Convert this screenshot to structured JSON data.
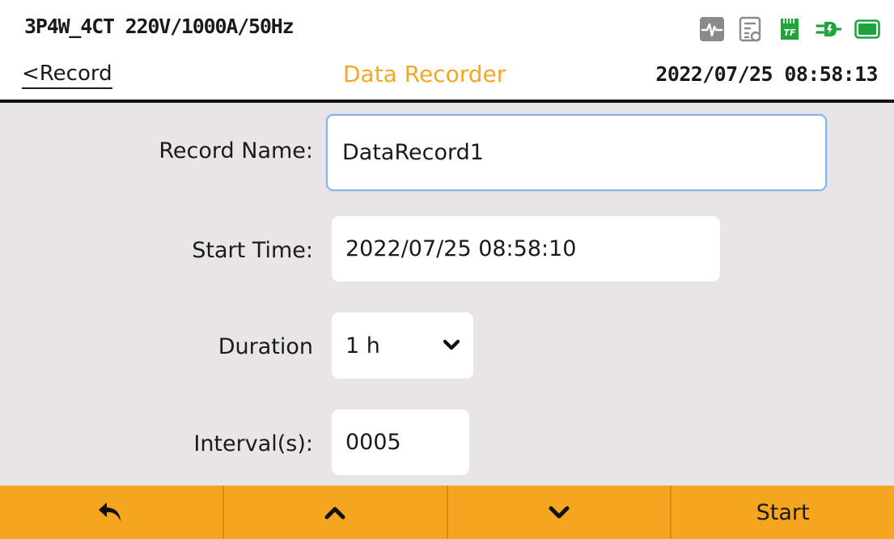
{
  "header": {
    "config": "3P4W_4CT 220V/1000A/50Hz",
    "back_label": "<Record",
    "title": "Data Recorder",
    "datetime": "2022/07/25 08:58:13",
    "title_color": "#f5a623",
    "status_icons": [
      "waveform-icon",
      "report-icon",
      "tf-card-icon",
      "plug-icon",
      "battery-icon"
    ],
    "tf_card_label": "TF"
  },
  "form": {
    "record_name": {
      "label": "Record Name:",
      "value": "DataRecord1"
    },
    "start_time": {
      "label": "Start Time:",
      "value": "2022/07/25 08:58:10"
    },
    "duration": {
      "label": "Duration",
      "value": "1 h"
    },
    "interval": {
      "label": "Interval(s):",
      "value": "0005"
    }
  },
  "bottom_bar": {
    "buttons": [
      {
        "name": "back-arrow-icon"
      },
      {
        "name": "chevron-up-icon"
      },
      {
        "name": "chevron-down-icon"
      },
      {
        "label": "Start"
      }
    ],
    "color": "#f6a520"
  },
  "colors": {
    "accent": "#f5a623",
    "status_green": "#1fa33a",
    "status_gray": "#8a8a8a",
    "form_background": "#e8e4e7",
    "focus_border": "#8ab4e3"
  }
}
